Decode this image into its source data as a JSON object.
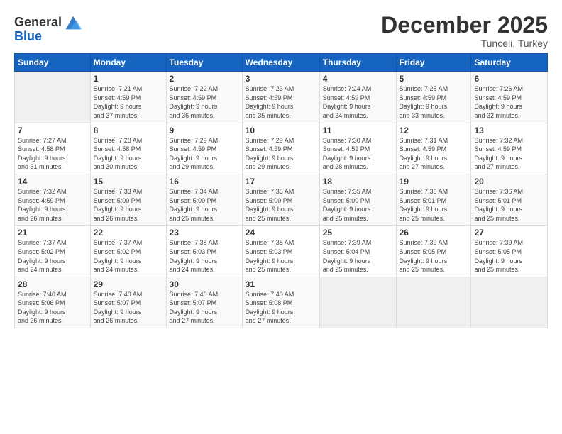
{
  "logo": {
    "general": "General",
    "blue": "Blue"
  },
  "header": {
    "month": "December 2025",
    "location": "Tunceli, Turkey"
  },
  "weekdays": [
    "Sunday",
    "Monday",
    "Tuesday",
    "Wednesday",
    "Thursday",
    "Friday",
    "Saturday"
  ],
  "weeks": [
    [
      {
        "day": "",
        "detail": ""
      },
      {
        "day": "1",
        "detail": "Sunrise: 7:21 AM\nSunset: 4:59 PM\nDaylight: 9 hours\nand 37 minutes."
      },
      {
        "day": "2",
        "detail": "Sunrise: 7:22 AM\nSunset: 4:59 PM\nDaylight: 9 hours\nand 36 minutes."
      },
      {
        "day": "3",
        "detail": "Sunrise: 7:23 AM\nSunset: 4:59 PM\nDaylight: 9 hours\nand 35 minutes."
      },
      {
        "day": "4",
        "detail": "Sunrise: 7:24 AM\nSunset: 4:59 PM\nDaylight: 9 hours\nand 34 minutes."
      },
      {
        "day": "5",
        "detail": "Sunrise: 7:25 AM\nSunset: 4:59 PM\nDaylight: 9 hours\nand 33 minutes."
      },
      {
        "day": "6",
        "detail": "Sunrise: 7:26 AM\nSunset: 4:59 PM\nDaylight: 9 hours\nand 32 minutes."
      }
    ],
    [
      {
        "day": "7",
        "detail": "Sunrise: 7:27 AM\nSunset: 4:58 PM\nDaylight: 9 hours\nand 31 minutes."
      },
      {
        "day": "8",
        "detail": "Sunrise: 7:28 AM\nSunset: 4:58 PM\nDaylight: 9 hours\nand 30 minutes."
      },
      {
        "day": "9",
        "detail": "Sunrise: 7:29 AM\nSunset: 4:59 PM\nDaylight: 9 hours\nand 29 minutes."
      },
      {
        "day": "10",
        "detail": "Sunrise: 7:29 AM\nSunset: 4:59 PM\nDaylight: 9 hours\nand 29 minutes."
      },
      {
        "day": "11",
        "detail": "Sunrise: 7:30 AM\nSunset: 4:59 PM\nDaylight: 9 hours\nand 28 minutes."
      },
      {
        "day": "12",
        "detail": "Sunrise: 7:31 AM\nSunset: 4:59 PM\nDaylight: 9 hours\nand 27 minutes."
      },
      {
        "day": "13",
        "detail": "Sunrise: 7:32 AM\nSunset: 4:59 PM\nDaylight: 9 hours\nand 27 minutes."
      }
    ],
    [
      {
        "day": "14",
        "detail": "Sunrise: 7:32 AM\nSunset: 4:59 PM\nDaylight: 9 hours\nand 26 minutes."
      },
      {
        "day": "15",
        "detail": "Sunrise: 7:33 AM\nSunset: 5:00 PM\nDaylight: 9 hours\nand 26 minutes."
      },
      {
        "day": "16",
        "detail": "Sunrise: 7:34 AM\nSunset: 5:00 PM\nDaylight: 9 hours\nand 25 minutes."
      },
      {
        "day": "17",
        "detail": "Sunrise: 7:35 AM\nSunset: 5:00 PM\nDaylight: 9 hours\nand 25 minutes."
      },
      {
        "day": "18",
        "detail": "Sunrise: 7:35 AM\nSunset: 5:00 PM\nDaylight: 9 hours\nand 25 minutes."
      },
      {
        "day": "19",
        "detail": "Sunrise: 7:36 AM\nSunset: 5:01 PM\nDaylight: 9 hours\nand 25 minutes."
      },
      {
        "day": "20",
        "detail": "Sunrise: 7:36 AM\nSunset: 5:01 PM\nDaylight: 9 hours\nand 25 minutes."
      }
    ],
    [
      {
        "day": "21",
        "detail": "Sunrise: 7:37 AM\nSunset: 5:02 PM\nDaylight: 9 hours\nand 24 minutes."
      },
      {
        "day": "22",
        "detail": "Sunrise: 7:37 AM\nSunset: 5:02 PM\nDaylight: 9 hours\nand 24 minutes."
      },
      {
        "day": "23",
        "detail": "Sunrise: 7:38 AM\nSunset: 5:03 PM\nDaylight: 9 hours\nand 24 minutes."
      },
      {
        "day": "24",
        "detail": "Sunrise: 7:38 AM\nSunset: 5:03 PM\nDaylight: 9 hours\nand 25 minutes."
      },
      {
        "day": "25",
        "detail": "Sunrise: 7:39 AM\nSunset: 5:04 PM\nDaylight: 9 hours\nand 25 minutes."
      },
      {
        "day": "26",
        "detail": "Sunrise: 7:39 AM\nSunset: 5:05 PM\nDaylight: 9 hours\nand 25 minutes."
      },
      {
        "day": "27",
        "detail": "Sunrise: 7:39 AM\nSunset: 5:05 PM\nDaylight: 9 hours\nand 25 minutes."
      }
    ],
    [
      {
        "day": "28",
        "detail": "Sunrise: 7:40 AM\nSunset: 5:06 PM\nDaylight: 9 hours\nand 26 minutes."
      },
      {
        "day": "29",
        "detail": "Sunrise: 7:40 AM\nSunset: 5:07 PM\nDaylight: 9 hours\nand 26 minutes."
      },
      {
        "day": "30",
        "detail": "Sunrise: 7:40 AM\nSunset: 5:07 PM\nDaylight: 9 hours\nand 27 minutes."
      },
      {
        "day": "31",
        "detail": "Sunrise: 7:40 AM\nSunset: 5:08 PM\nDaylight: 9 hours\nand 27 minutes."
      },
      {
        "day": "",
        "detail": ""
      },
      {
        "day": "",
        "detail": ""
      },
      {
        "day": "",
        "detail": ""
      }
    ]
  ]
}
